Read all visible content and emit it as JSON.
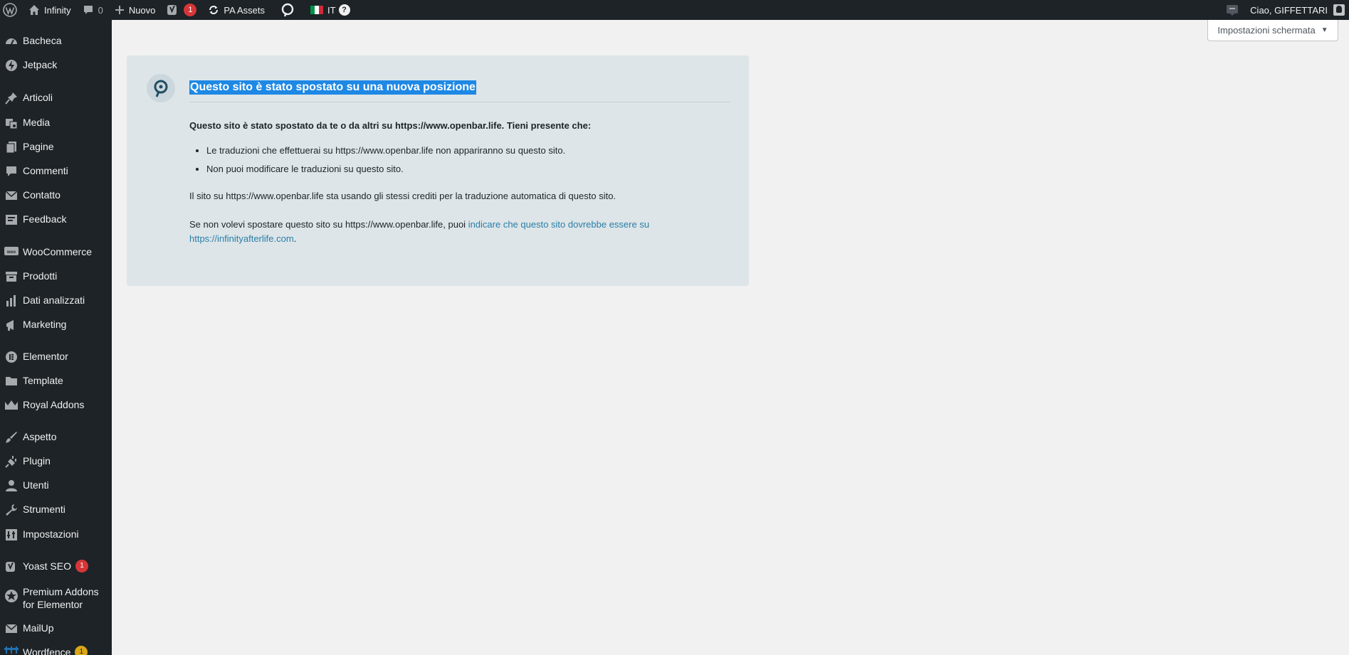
{
  "adminbar": {
    "site_name": "Infinity",
    "comments_count": "0",
    "new_label": "Nuovo",
    "yoast_badge": "1",
    "pa_assets_label": "PA Assets",
    "language_code": "IT",
    "language_help": "?",
    "greeting": "Ciao, GIFFETTARI",
    "colors": {
      "bar_bg": "#1d2327",
      "badge": "#d63638"
    }
  },
  "screen_options": {
    "label": "Impostazioni schermata",
    "arrow": "▼"
  },
  "sidebar": {
    "items": [
      {
        "label": "Bacheca",
        "icon": "dashboard-icon"
      },
      {
        "label": "Jetpack",
        "icon": "jetpack-icon"
      },
      {
        "label": "Articoli",
        "icon": "pin-icon"
      },
      {
        "label": "Media",
        "icon": "media-icon"
      },
      {
        "label": "Pagine",
        "icon": "pages-icon"
      },
      {
        "label": "Commenti",
        "icon": "comment-icon"
      },
      {
        "label": "Contatto",
        "icon": "mail-icon"
      },
      {
        "label": "Feedback",
        "icon": "feedback-icon"
      },
      {
        "label": "WooCommerce",
        "icon": "woo-icon"
      },
      {
        "label": "Prodotti",
        "icon": "archive-icon"
      },
      {
        "label": "Dati analizzati",
        "icon": "chart-bar-icon"
      },
      {
        "label": "Marketing",
        "icon": "megaphone-icon"
      },
      {
        "label": "Elementor",
        "icon": "elementor-icon"
      },
      {
        "label": "Template",
        "icon": "folder-icon"
      },
      {
        "label": "Royal Addons",
        "icon": "crown-icon"
      },
      {
        "label": "Aspetto",
        "icon": "brush-icon"
      },
      {
        "label": "Plugin",
        "icon": "plug-icon"
      },
      {
        "label": "Utenti",
        "icon": "user-icon"
      },
      {
        "label": "Strumenti",
        "icon": "wrench-icon"
      },
      {
        "label": "Impostazioni",
        "icon": "settings-icon"
      },
      {
        "label": "Yoast SEO",
        "icon": "yoast-icon",
        "badge": "1"
      },
      {
        "label": "Premium Addons for Elementor",
        "icon": "star-icon"
      },
      {
        "label": "MailUp",
        "icon": "envelope-icon"
      },
      {
        "label": "Wordfence",
        "icon": "wordfence-icon",
        "badge": "1"
      }
    ]
  },
  "notice": {
    "title": "Questo sito è stato spostato su una nuova posizione",
    "intro": "Questo sito è stato spostato da te o da altri su https://www.openbar.life. Tieni presente che:",
    "bullets": [
      "Le traduzioni che effettuerai su https://www.openbar.life non appariranno su questo sito.",
      "Non puoi modificare le traduzioni su questo sito."
    ],
    "credits_text": "Il sito su https://www.openbar.life sta usando gli stessi crediti per la traduzione automatica di questo sito.",
    "moved_prefix": "Se non volevi spostare questo sito su https://www.openbar.life, puoi ",
    "moved_link": "indicare che questo sito dovrebbe essere su https://infinityafterlife.com",
    "moved_suffix": ".",
    "colors": {
      "card_bg": "#dde5e8",
      "link": "#2a7ea8",
      "selection": "#1e88e5"
    }
  }
}
